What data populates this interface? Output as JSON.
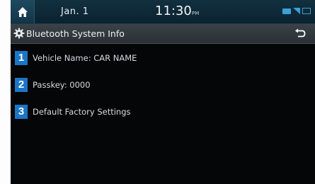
{
  "status_bar": {
    "home_icon": "home-icon",
    "date": "Jan.  1",
    "time": "11:30",
    "time_suffix": "PM",
    "icons": [
      "bluetooth-icon",
      "signal-icon",
      "battery-icon"
    ]
  },
  "title_bar": {
    "icon": "gear-icon",
    "title": "Bluetooth System Info",
    "back_icon": "back-arrow-icon"
  },
  "menu": {
    "items": [
      {
        "number": "1",
        "label": "Vehicle Name: CAR NAME"
      },
      {
        "number": "2",
        "label": "Passkey: 0000"
      },
      {
        "number": "3",
        "label": "Default Factory Settings"
      }
    ]
  },
  "colors": {
    "badge": "#1b76c8",
    "background": "#050607",
    "status_bar": "#12303f",
    "title_bar": "#353b40"
  }
}
